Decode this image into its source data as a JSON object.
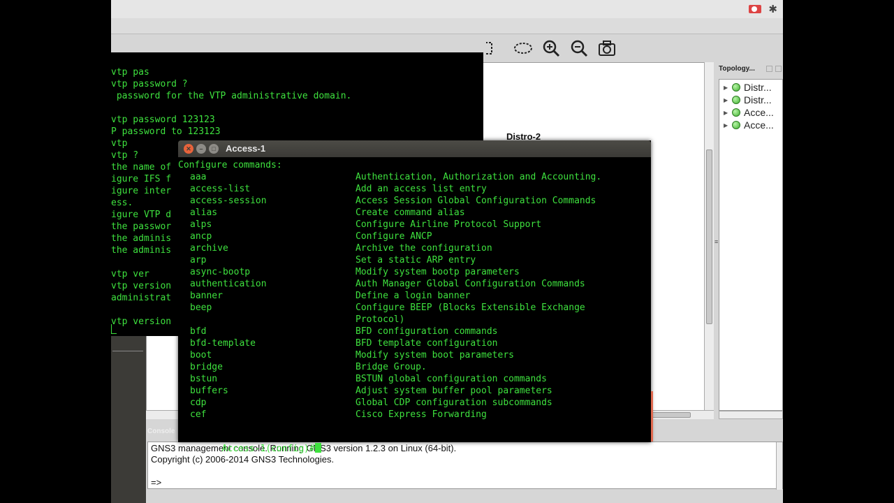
{
  "system_bar": {
    "icons": [
      "record-icon",
      "bluetooth-icon"
    ]
  },
  "gns3": {
    "toolbar": {
      "icons": [
        "rectangle-icon",
        "ellipse-icon",
        "zoom-in-icon",
        "zoom-out-icon",
        "screenshot-icon"
      ]
    },
    "canvas": {
      "node_label": "Distro-2"
    },
    "topology": {
      "title": "Topology...",
      "items": [
        {
          "label": "Distr...",
          "status_color": "#3fb12f"
        },
        {
          "label": "Distr...",
          "status_color": "#3fb12f"
        },
        {
          "label": "Acce...",
          "status_color": "#3fb12f"
        },
        {
          "label": "Acce...",
          "status_color": "#3fb12f"
        }
      ]
    },
    "console": {
      "title": "Console",
      "line1": "GNS3 management console. Running GNS3 version 1.2.3 on Linux (64-bit).",
      "line2": "Copyright (c) 2006-2014 GNS3 Technologies.",
      "prompt": "=>"
    }
  },
  "background_terminal": {
    "lines": [
      "vtp pas",
      "vtp password ?",
      " password for the VTP administrative domain.",
      "",
      "vtp password 123123",
      "P password to 123123",
      "vtp",
      "vtp ?",
      "the name of",
      "igure IFS f",
      "igure inter",
      "ess.",
      "igure VTP d",
      "the passwor",
      "the adminis",
      "the adminis",
      "",
      "vtp ver",
      "vtp version",
      "administrat",
      "",
      "vtp version"
    ]
  },
  "access_terminal": {
    "title": "Access-1",
    "header": "Configure commands:",
    "commands": [
      {
        "cmd": "aaa",
        "desc": "Authentication, Authorization and Accounting."
      },
      {
        "cmd": "access-list",
        "desc": "Add an access list entry"
      },
      {
        "cmd": "access-session",
        "desc": "Access Session Global Configuration Commands"
      },
      {
        "cmd": "alias",
        "desc": "Create command alias"
      },
      {
        "cmd": "alps",
        "desc": "Configure Airline Protocol Support"
      },
      {
        "cmd": "ancp",
        "desc": "Configure ANCP"
      },
      {
        "cmd": "archive",
        "desc": "Archive the configuration"
      },
      {
        "cmd": "arp",
        "desc": "Set a static ARP entry"
      },
      {
        "cmd": "async-bootp",
        "desc": "Modify system bootp parameters"
      },
      {
        "cmd": "authentication",
        "desc": "Auth Manager Global Configuration Commands"
      },
      {
        "cmd": "banner",
        "desc": "Define a login banner"
      },
      {
        "cmd": "beep",
        "desc": "Configure BEEP (Blocks Extensible Exchange"
      },
      {
        "cmd": "",
        "desc": "Protocol)"
      },
      {
        "cmd": "bfd",
        "desc": "BFD configuration commands"
      },
      {
        "cmd": "bfd-template",
        "desc": "BFD template configuration"
      },
      {
        "cmd": "boot",
        "desc": "Modify system boot parameters"
      },
      {
        "cmd": "bridge",
        "desc": "Bridge Group."
      },
      {
        "cmd": "bstun",
        "desc": "BSTUN global configuration commands"
      },
      {
        "cmd": "buffers",
        "desc": "Adjust system buffer pool parameters"
      },
      {
        "cmd": "cdp",
        "desc": "Global CDP configuration subcommands"
      },
      {
        "cmd": "cef",
        "desc": "Cisco Express Forwarding"
      }
    ],
    "prompt": "Access-1(config)#",
    "text_color": "#3ee13e"
  }
}
